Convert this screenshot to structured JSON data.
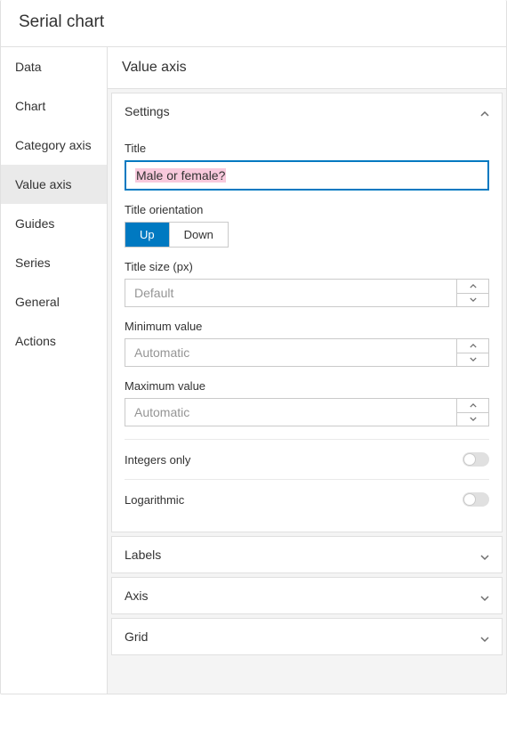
{
  "header": {
    "title": "Serial chart"
  },
  "sidebar": {
    "items": [
      {
        "label": "Data"
      },
      {
        "label": "Chart"
      },
      {
        "label": "Category axis"
      },
      {
        "label": "Value axis"
      },
      {
        "label": "Guides"
      },
      {
        "label": "Series"
      },
      {
        "label": "General"
      },
      {
        "label": "Actions"
      }
    ],
    "activeIndex": 3
  },
  "main": {
    "title": "Value axis",
    "sections": {
      "settings": {
        "title": "Settings",
        "fields": {
          "title": {
            "label": "Title",
            "value": "Male or female?"
          },
          "orientation": {
            "label": "Title orientation",
            "options": [
              "Up",
              "Down"
            ],
            "selected": "Up"
          },
          "titleSize": {
            "label": "Title size (px)",
            "placeholder": "Default",
            "value": ""
          },
          "minimum": {
            "label": "Minimum value",
            "placeholder": "Automatic",
            "value": ""
          },
          "maximum": {
            "label": "Maximum value",
            "placeholder": "Automatic",
            "value": ""
          },
          "integersOnly": {
            "label": "Integers only",
            "value": false
          },
          "logarithmic": {
            "label": "Logarithmic",
            "value": false
          }
        }
      },
      "labels": {
        "title": "Labels"
      },
      "axis": {
        "title": "Axis"
      },
      "grid": {
        "title": "Grid"
      }
    }
  }
}
